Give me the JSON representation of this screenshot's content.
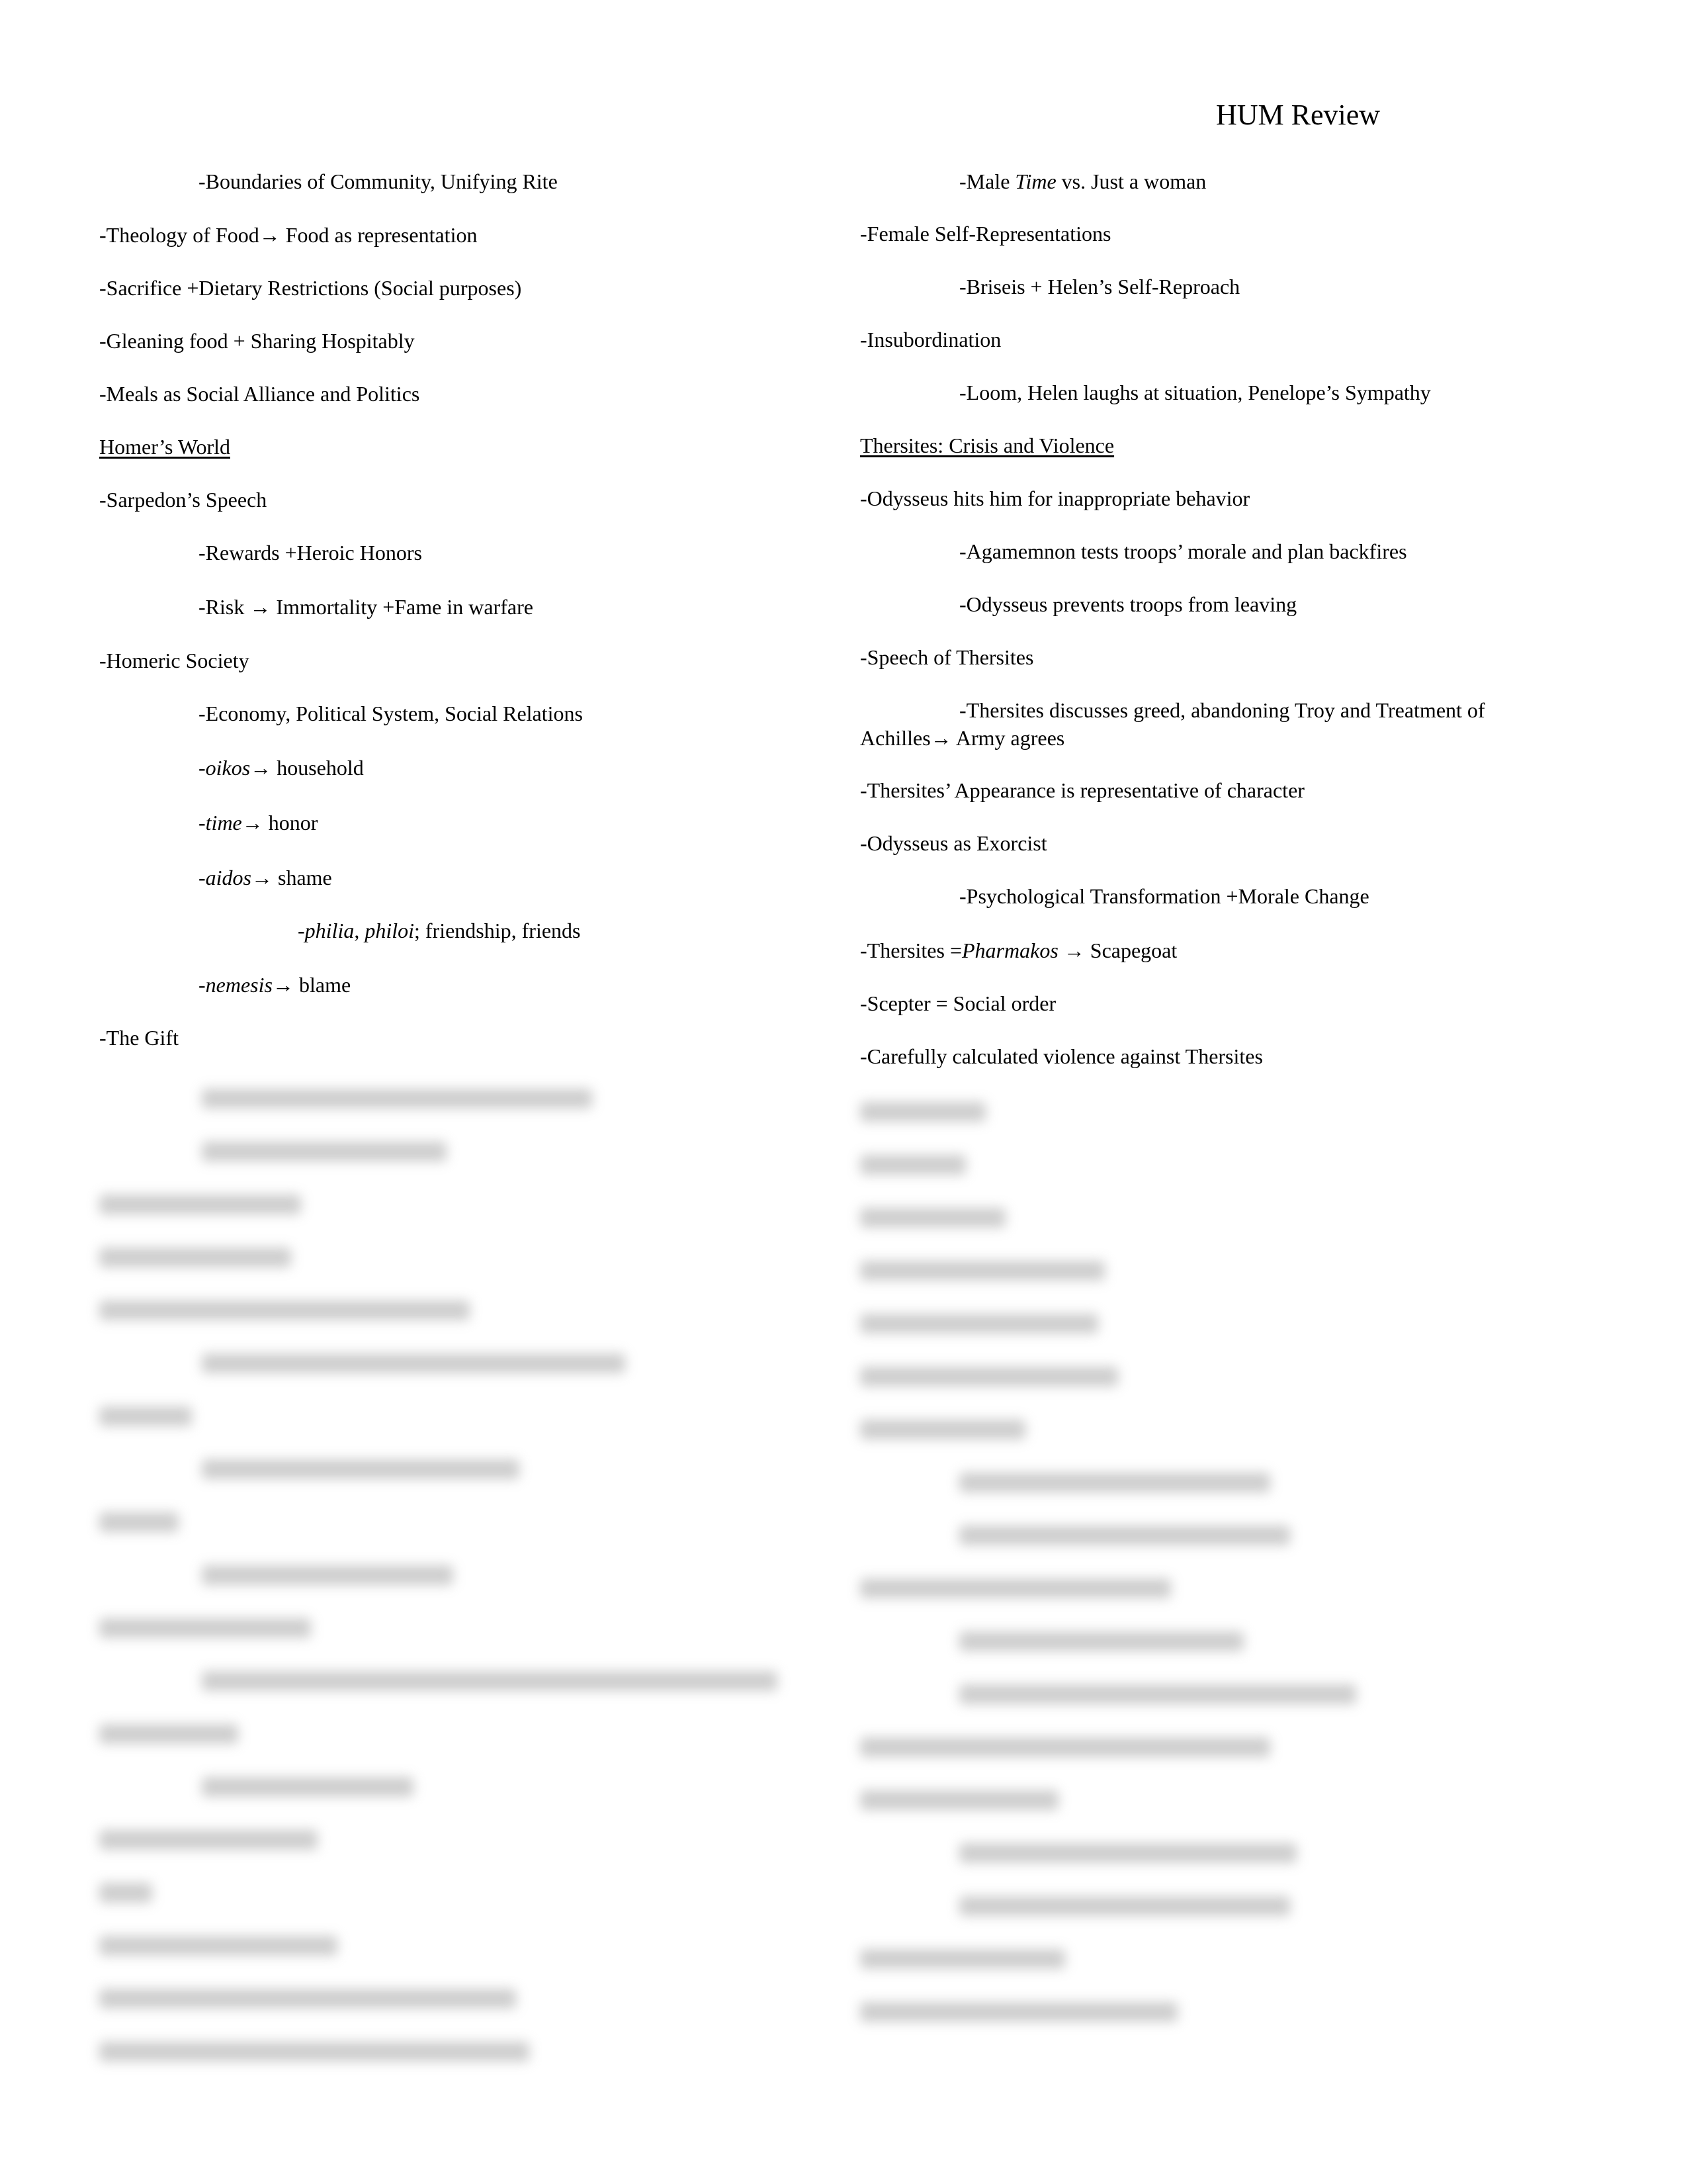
{
  "document": {
    "title": "HUM Review",
    "arrow": "→",
    "left_column": [
      {
        "id": "boundaries",
        "text": "-Boundaries of Community, Unifying Rite"
      },
      {
        "id": "theology",
        "pre": "-Theology of Food",
        "post": " Food as representation"
      },
      {
        "id": "sacrifice",
        "text": "-Sacrifice +Dietary Restrictions (Social purposes)"
      },
      {
        "id": "gleaning",
        "text": "-Gleaning food + Sharing Hospitably"
      },
      {
        "id": "meals",
        "text": "-Meals as Social Alliance and Politics"
      },
      {
        "id": "homers-world",
        "text": "Homer’s World"
      },
      {
        "id": "sarpedon",
        "text": "-Sarpedon’s Speech"
      },
      {
        "id": "rewards",
        "text": "-Rewards +Heroic Honors"
      },
      {
        "id": "risk",
        "pre": "-Risk ",
        "post": " Immortality +Fame in warfare"
      },
      {
        "id": "homeric-society",
        "text": "-Homeric Society"
      },
      {
        "id": "economy",
        "text": "-Economy, Political System, Social Relations"
      },
      {
        "id": "oikos",
        "term": "oikos",
        "post": " household"
      },
      {
        "id": "time",
        "term": "time",
        "post": " honor"
      },
      {
        "id": "aidos",
        "term": "aidos",
        "post": " shame"
      },
      {
        "id": "philia",
        "term1": "philia",
        "sep": ", ",
        "term2": "philoi",
        "post": "; friendship, friends"
      },
      {
        "id": "nemesis",
        "term": "nemesis",
        "post": " blame"
      },
      {
        "id": "gift",
        "text": "-The Gift"
      }
    ],
    "right_column": [
      {
        "id": "male-time",
        "pre": "-Male ",
        "term": "Time",
        "post": " vs. Just a woman"
      },
      {
        "id": "female-self",
        "text": "-Female Self-Representations"
      },
      {
        "id": "briseis",
        "text": "-Briseis + Helen’s Self-Reproach"
      },
      {
        "id": "insubordination",
        "text": "-Insubordination"
      },
      {
        "id": "loom",
        "text": "-Loom, Helen laughs at situation, Penelope’s Sympathy"
      },
      {
        "id": "thersites-heading",
        "text": "Thersites: Crisis and Violence"
      },
      {
        "id": "odysseus-hits",
        "text": "-Odysseus hits him for inappropriate behavior"
      },
      {
        "id": "agamemnon",
        "text": "-Agamemnon tests troops’ morale and plan backfires"
      },
      {
        "id": "odysseus-prevents",
        "text": "-Odysseus prevents troops from leaving"
      },
      {
        "id": "speech-thersites",
        "text": "-Speech of Thersites"
      },
      {
        "id": "thersites-discusses",
        "line1": "-Thersites discusses greed, abandoning Troy and Treatment of",
        "line2pre": "Achilles",
        "line2post": " Army agrees"
      },
      {
        "id": "appearance",
        "text": "-Thersites’ Appearance is representative of character"
      },
      {
        "id": "exorcist",
        "text": "-Odysseus as Exorcist"
      },
      {
        "id": "psychological",
        "text": "-Psychological Transformation +Morale Change"
      },
      {
        "id": "pharmakos",
        "pre": "-Thersites =",
        "term": "Pharmakos",
        "post": " Scapegoat"
      },
      {
        "id": "scepter",
        "text": "-Scepter = Social order"
      },
      {
        "id": "calculated",
        "text": "-Carefully calculated violence against Thersites"
      }
    ]
  }
}
